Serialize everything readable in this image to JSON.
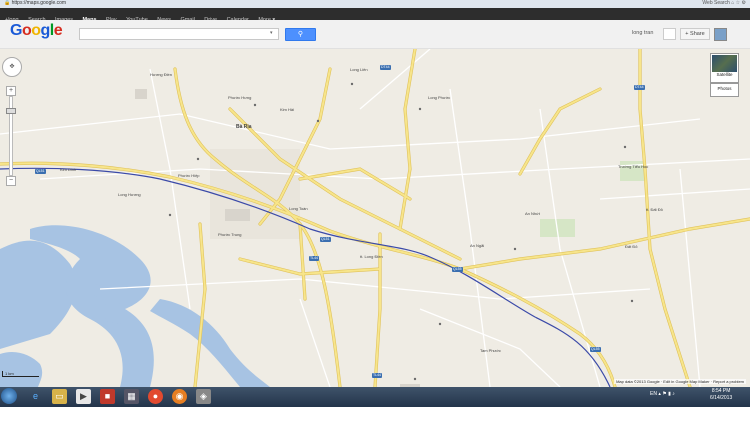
{
  "browser": {
    "url": "https://maps.google.com",
    "search_placeholder": "Web Search"
  },
  "gbar": {
    "items": [
      "+long",
      "Search",
      "Images",
      "Maps",
      "Play",
      "YouTube",
      "News",
      "Gmail",
      "Drive",
      "Calendar",
      "More ▾"
    ],
    "active": "Maps"
  },
  "header": {
    "logo": "Google",
    "search_value": "",
    "search_icon": "magnifier-icon",
    "user_name": "long tran",
    "share_label": "+ Share"
  },
  "map_controls": {
    "zoom_in": "+",
    "zoom_out": "−",
    "satellite_label": "Satellite",
    "photos_label": "Photos"
  },
  "map_labels": [
    {
      "id": "huong-dien",
      "text": "Hương Điền"
    },
    {
      "id": "phuoc-hung",
      "text": "Phước Hưng"
    },
    {
      "id": "ba-ria",
      "text": "Bà Rịa"
    },
    {
      "id": "kim-dinh",
      "text": "Kim Dinh"
    },
    {
      "id": "phuoc-hiep",
      "text": "Phước Hiệp"
    },
    {
      "id": "long-huong",
      "text": "Long Hương"
    },
    {
      "id": "long-toan",
      "text": "Long Toàn"
    },
    {
      "id": "long-phuoc",
      "text": "Long Phước"
    },
    {
      "id": "phuoc-trung",
      "text": "Phước Trung"
    },
    {
      "id": "long-dien",
      "text": "tt. Long Điền"
    },
    {
      "id": "an-ngai",
      "text": "An Ngãi"
    },
    {
      "id": "an-nhat",
      "text": "An Nhứt"
    },
    {
      "id": "tam-phuoc",
      "text": "Tam Phước"
    },
    {
      "id": "dat-do",
      "text": "Đất Đỏ"
    },
    {
      "id": "tt-dat-do",
      "text": "tt. Đất Đỏ"
    },
    {
      "id": "long-lien",
      "text": "Long Liên"
    },
    {
      "id": "tan-hai",
      "text": "Kim Hải"
    },
    {
      "id": "tieu-hoc",
      "text": "Trường Tiểu Học"
    }
  ],
  "road_shields": {
    "ql51": "QL51",
    "ql55": "QL55",
    "dt44": "DT44",
    "tl44": "TL44"
  },
  "map_footer": {
    "scale": "1 km",
    "data_text": "Map data ©2013 Google · Edit in Google Map Maker · Report a problem"
  },
  "taskbar": {
    "tray_lang": "EN",
    "time": "8:54 PM",
    "date": "6/14/2013"
  },
  "colors": {
    "gbar": "#2d2d2d",
    "search_button": "#4d90fe",
    "road_yellow": "#f7e58b",
    "road_edge": "#e0c25a",
    "water": "#a7c3e3",
    "route": "#3b4aa8",
    "park": "#cfe3b9"
  }
}
